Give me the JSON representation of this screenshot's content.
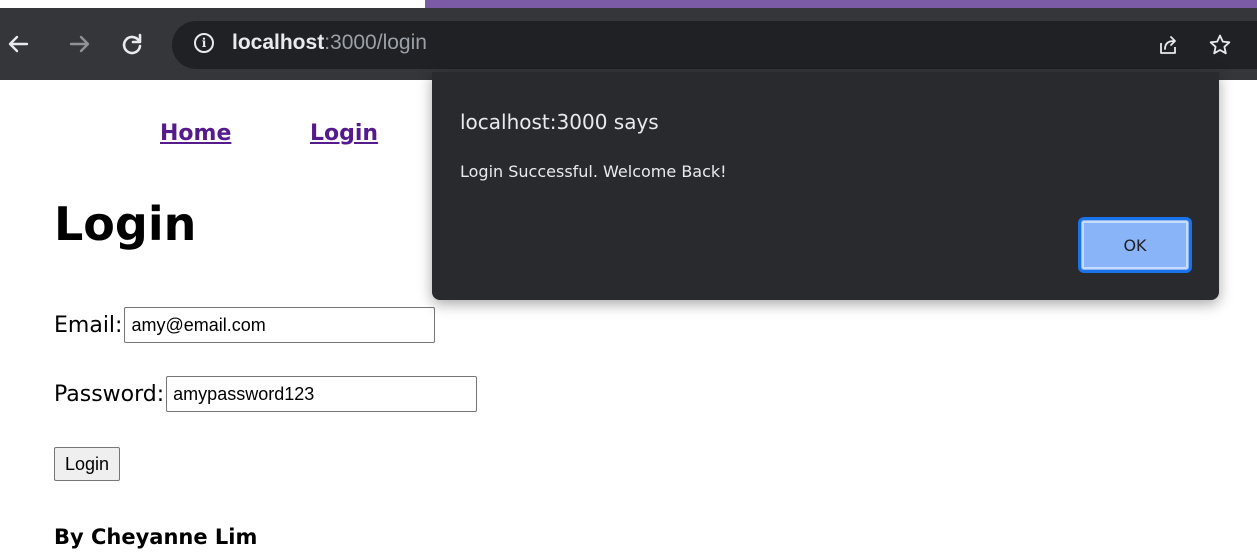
{
  "browser": {
    "url_host": "localhost",
    "url_path": ":3000/login",
    "icons": [
      "back-arrow-icon",
      "forward-arrow-icon",
      "reload-icon",
      "info-icon",
      "share-icon",
      "bookmark-star-icon"
    ],
    "colors": {
      "toolbar": "#35363a",
      "omnibox": "#202124",
      "accent_strip": "#7b5aa6"
    }
  },
  "page": {
    "nav": {
      "home": "Home",
      "login": "Login"
    },
    "title": "Login",
    "email_label": "Email:",
    "email_value": "amy@email.com",
    "password_label": "Password:",
    "password_value": "amypassword123",
    "submit_label": "Login",
    "byline": "By Cheyanne Lim"
  },
  "dialog": {
    "title": "localhost:3000 says",
    "message": "Login Successful. Welcome Back!",
    "ok_label": "OK",
    "colors": {
      "background": "#292a2d",
      "button": "#8ab4f8"
    }
  }
}
